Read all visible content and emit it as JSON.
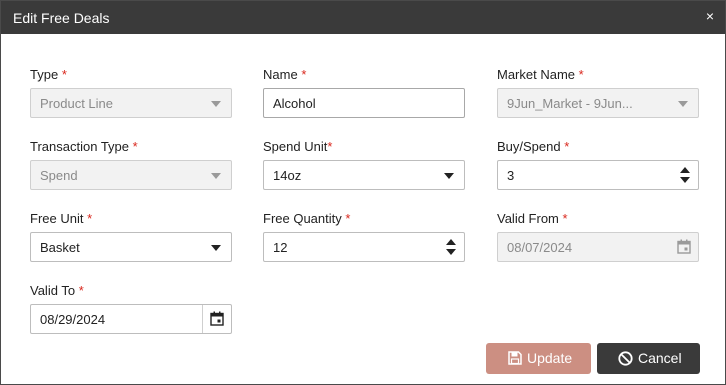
{
  "dialog": {
    "title": "Edit Free Deals",
    "close_glyph": "×"
  },
  "required_mark": "*",
  "fields": {
    "type": {
      "label": "Type",
      "value": "Product Line",
      "control": "select",
      "disabled": true
    },
    "name": {
      "label": "Name",
      "value": "Alcohol",
      "control": "text"
    },
    "market_name": {
      "label": "Market Name",
      "value": "9Jun_Market - 9Jun...",
      "control": "select",
      "disabled": true
    },
    "transaction_type": {
      "label": "Transaction Type",
      "value": "Spend",
      "control": "select",
      "disabled": true
    },
    "spend_unit": {
      "label": "Spend Unit",
      "value": "14oz",
      "control": "select"
    },
    "buy_spend": {
      "label": "Buy/Spend",
      "value": "3",
      "control": "number"
    },
    "free_unit": {
      "label": "Free Unit",
      "value": "Basket",
      "control": "select"
    },
    "free_quantity": {
      "label": "Free Quantity",
      "value": "12",
      "control": "number"
    },
    "valid_from": {
      "label": "Valid From",
      "value": "08/07/2024",
      "control": "date",
      "disabled": true
    },
    "valid_to": {
      "label": "Valid To",
      "value": "08/29/2024",
      "control": "date"
    }
  },
  "buttons": {
    "update_label": "Update",
    "cancel_label": "Cancel"
  },
  "colors": {
    "titlebar": "#3a3a3a",
    "required": "#d9261c",
    "update_button": "#cc8f82",
    "cancel_button": "#3a3a3a"
  },
  "icons": [
    "close-icon",
    "dropdown-caret-icon",
    "spinner-arrows-icon",
    "calendar-icon",
    "save-icon",
    "cancel-circle-icon"
  ]
}
